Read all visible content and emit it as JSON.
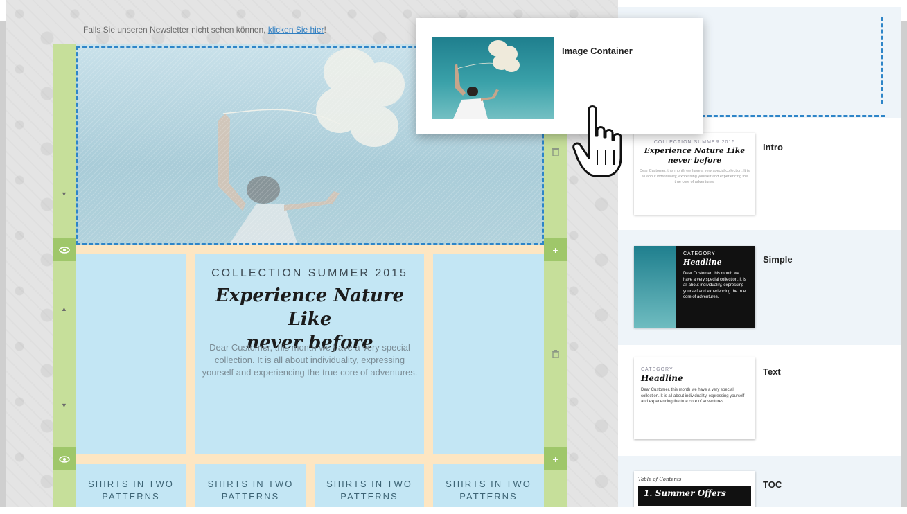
{
  "notice": {
    "text": "Falls Sie unseren Newsletter nicht sehen können, ",
    "link": "klicken Sie hier",
    "suffix": "!"
  },
  "hero": {
    "alt": "woman with balloons"
  },
  "content": {
    "collection": "COLLECTION SUMMER 2015",
    "headline_line1": "Experience Nature Like",
    "headline_line2": "never before",
    "body": "Dear Customer, this month we have a very special collection. It is all about individuality, expressing yourself and experiencing the true core of adventures.",
    "shirts": [
      {
        "line1": "SHIRTS IN TWO",
        "line2": "PATTERNS"
      },
      {
        "line1": "SHIRTS IN TWO",
        "line2": "PATTERNS"
      },
      {
        "line1": "SHIRTS IN TWO",
        "line2": "PATTERNS"
      },
      {
        "line1": "SHIRTS IN TWO",
        "line2": "PATTERNS"
      }
    ]
  },
  "drag_card": {
    "title": "Image Container"
  },
  "panel": {
    "items": [
      {
        "title": "Intro",
        "kicker": "COLLECTION SUMMER 2015",
        "headline1": "Experience Nature Like",
        "headline2": "never before",
        "body": "Dear Customer, this month we have a very special collection. It is all about individuality, expressing yourself and experiencing the true core of adventures."
      },
      {
        "title": "Simple",
        "kicker": "CATEGORY",
        "headline": "Headline",
        "body": "Dear Customer, this month we have a very special collection. It is all about individuality, expressing yourself and experiencing the true core of adventures."
      },
      {
        "title": "Text",
        "kicker": "CATEGORY",
        "headline": "Headline",
        "body": "Dear Customer, this month we have a very special collection. It is all about individuality, expressing yourself and experiencing the true core of adventures."
      },
      {
        "title": "TOC",
        "kicker": "Table of Contents",
        "headline": "1. Summer Offers"
      }
    ]
  },
  "icons": {
    "eye": "eye-icon",
    "plus": "plus-icon",
    "trash": "trash-icon",
    "arrow_up": "arrow-up-icon",
    "arrow_down": "arrow-down-icon",
    "cursor": "hand-cursor-icon"
  },
  "colors": {
    "rail": "#c6df9a",
    "rail_button": "#9fc76a",
    "dashed_selection": "#2e85c8",
    "cell_blue": "#c3e6f4",
    "band_cream": "#fde6c2",
    "panel_light": "#eef4f9"
  }
}
